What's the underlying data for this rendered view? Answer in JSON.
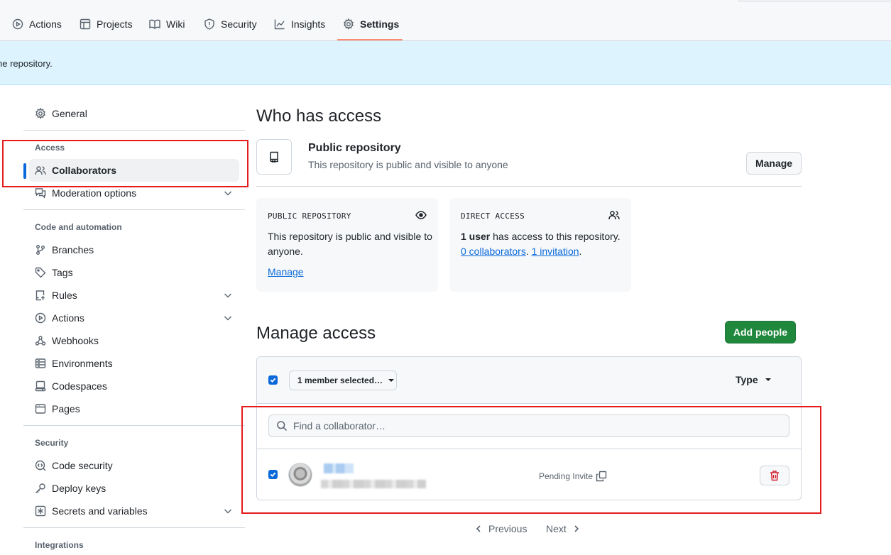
{
  "nav": {
    "tabs": [
      {
        "label": "Actions",
        "icon": "play-icon"
      },
      {
        "label": "Projects",
        "icon": "table-icon"
      },
      {
        "label": "Wiki",
        "icon": "book-icon"
      },
      {
        "label": "Security",
        "icon": "shield-icon"
      },
      {
        "label": "Insights",
        "icon": "graph-icon"
      },
      {
        "label": "Settings",
        "icon": "gear-icon",
        "active": true
      }
    ]
  },
  "banner": {
    "text": "he repository."
  },
  "sidebar": {
    "general": "General",
    "access_heading": "Access",
    "collaborators": "Collaborators",
    "moderation": "Moderation options",
    "code_heading": "Code and automation",
    "branches": "Branches",
    "tags": "Tags",
    "rules": "Rules",
    "actions": "Actions",
    "webhooks": "Webhooks",
    "environments": "Environments",
    "codespaces": "Codespaces",
    "pages": "Pages",
    "security_heading": "Security",
    "code_security": "Code security",
    "deploy_keys": "Deploy keys",
    "secrets": "Secrets and variables",
    "integrations_heading": "Integrations"
  },
  "who": {
    "title": "Who has access",
    "visibility_title": "Public repository",
    "visibility_desc": "This repository is public and visible to anyone",
    "manage_button": "Manage",
    "card_public": {
      "label": "PUBLIC REPOSITORY",
      "text": "This repository is public and visible to anyone.",
      "link": "Manage"
    },
    "card_direct": {
      "label": "DIRECT ACCESS",
      "count": "1 user",
      "text_after": " has access to this repository.",
      "collaborators_link": "0 collaborators",
      "sep": ".",
      "invitation_link": "1 invitation",
      "end": "."
    }
  },
  "manage": {
    "title": "Manage access",
    "add_button": "Add people",
    "member_selected": "1 member selected…",
    "type_label": "Type",
    "search_placeholder": "Find a collaborator…",
    "rows": [
      {
        "status": "Pending Invite"
      }
    ]
  },
  "pagination": {
    "previous": "Previous",
    "next": "Next"
  },
  "colors": {
    "accent": "#0969da",
    "primary_button": "#1f883d",
    "danger": "#d1242f",
    "highlight_box": "#e51c1c"
  }
}
